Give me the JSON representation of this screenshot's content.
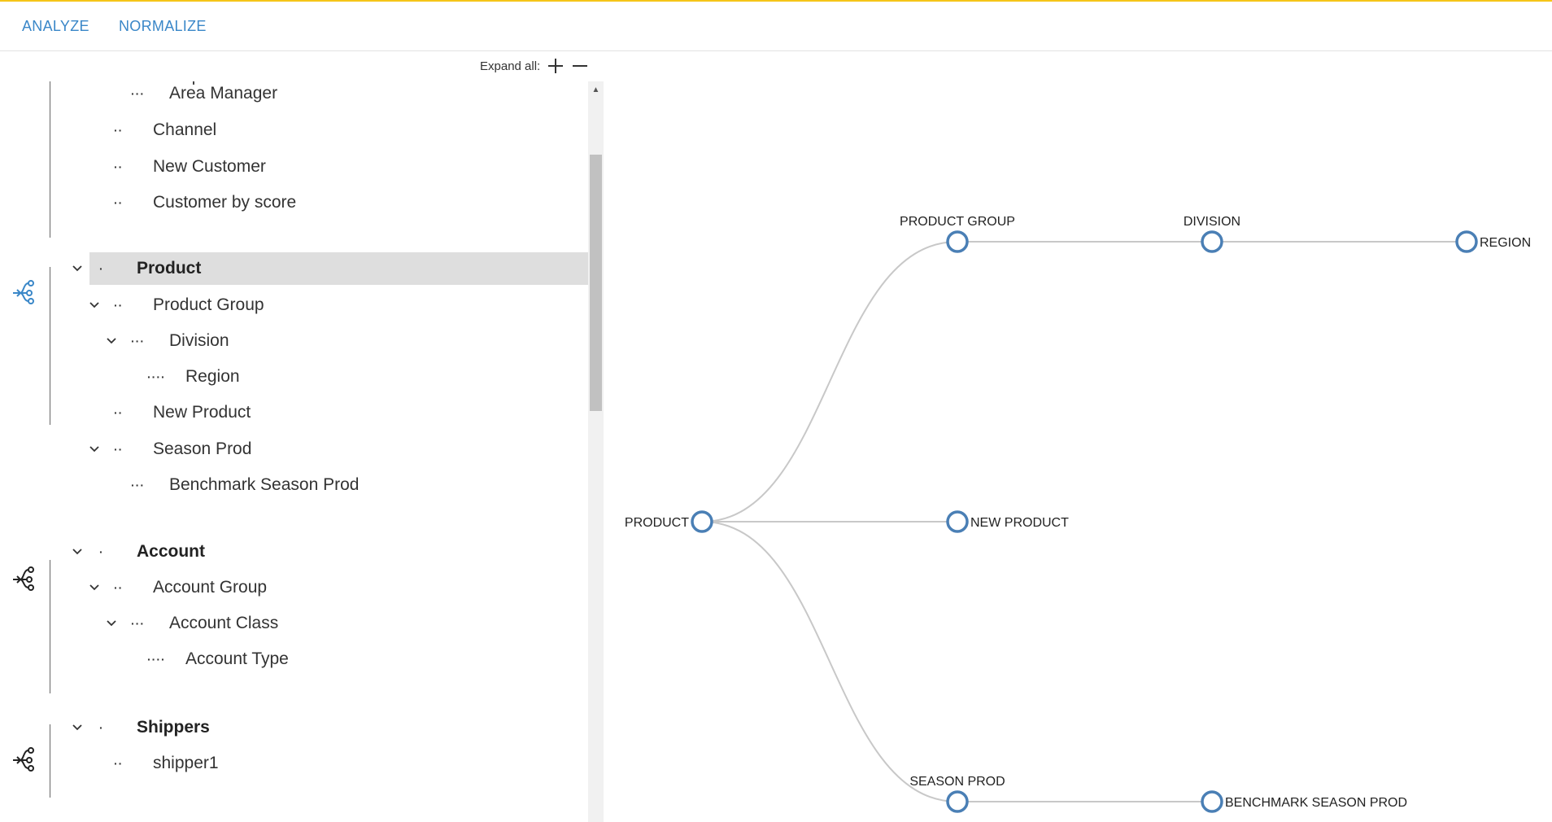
{
  "topbar": {
    "tabs": [
      {
        "label": "ANALYZE"
      },
      {
        "label": "NORMALIZE"
      }
    ],
    "accent_color": "#f5c518",
    "tab_color": "#3a87c8"
  },
  "expand": {
    "label": "Expand all:",
    "expand_icon": "plus-icon",
    "collapse_icon": "minus-icon"
  },
  "tree": {
    "rows": [
      {
        "label": "Area Manager",
        "dots": "···",
        "level": 3,
        "chevron": false,
        "bold": false
      },
      {
        "label": "Channel",
        "dots": "··",
        "level": 2,
        "chevron": false,
        "bold": false
      },
      {
        "label": "New Customer",
        "dots": "··",
        "level": 2,
        "chevron": false,
        "bold": false
      },
      {
        "label": "Customer by score",
        "dots": "··",
        "level": 2,
        "chevron": false,
        "bold": false
      },
      {
        "label": "Product",
        "dots": "·",
        "level": 1,
        "chevron": true,
        "bold": true,
        "selected": true
      },
      {
        "label": "Product Group",
        "dots": "··",
        "level": 2,
        "chevron": true,
        "bold": false
      },
      {
        "label": "Division",
        "dots": "···",
        "level": 3,
        "chevron": true,
        "bold": false
      },
      {
        "label": "Region",
        "dots": "····",
        "level": 4,
        "chevron": false,
        "bold": false
      },
      {
        "label": "New Product",
        "dots": "··",
        "level": 2,
        "chevron": false,
        "bold": false
      },
      {
        "label": "Season Prod",
        "dots": "··",
        "level": 2,
        "chevron": true,
        "bold": false
      },
      {
        "label": "Benchmark Season Prod",
        "dots": "···",
        "level": 3,
        "chevron": false,
        "bold": false
      },
      {
        "label": "Account",
        "dots": "·",
        "level": 1,
        "chevron": true,
        "bold": true
      },
      {
        "label": "Account Group",
        "dots": "··",
        "level": 2,
        "chevron": true,
        "bold": false
      },
      {
        "label": "Account Class",
        "dots": "···",
        "level": 3,
        "chevron": true,
        "bold": false
      },
      {
        "label": "Account Type",
        "dots": "····",
        "level": 4,
        "chevron": false,
        "bold": false
      },
      {
        "label": "Shippers",
        "dots": "·",
        "level": 1,
        "chevron": true,
        "bold": true
      },
      {
        "label": "shipper1",
        "dots": "··",
        "level": 2,
        "chevron": false,
        "bold": false
      }
    ],
    "group_icons": [
      {
        "name": "hierarchy-icon",
        "active": true,
        "color": "#3a87c8"
      },
      {
        "name": "hierarchy-icon",
        "active": false,
        "color": "#222222"
      },
      {
        "name": "hierarchy-icon",
        "active": false,
        "color": "#222222"
      }
    ]
  },
  "graph": {
    "node_stroke": "#4a7fb5",
    "link_color": "#c8c8c8",
    "nodes": [
      {
        "id": "product",
        "label": "PRODUCT"
      },
      {
        "id": "product_group",
        "label": "PRODUCT GROUP"
      },
      {
        "id": "division",
        "label": "DIVISION"
      },
      {
        "id": "region",
        "label": "REGION"
      },
      {
        "id": "new_product",
        "label": "NEW PRODUCT"
      },
      {
        "id": "season_prod",
        "label": "SEASON PROD"
      },
      {
        "id": "benchmark",
        "label": "BENCHMARK SEASON PROD"
      }
    ],
    "links": [
      [
        "product",
        "product_group"
      ],
      [
        "product_group",
        "division"
      ],
      [
        "division",
        "region"
      ],
      [
        "product",
        "new_product"
      ],
      [
        "product",
        "season_prod"
      ],
      [
        "season_prod",
        "benchmark"
      ]
    ]
  }
}
